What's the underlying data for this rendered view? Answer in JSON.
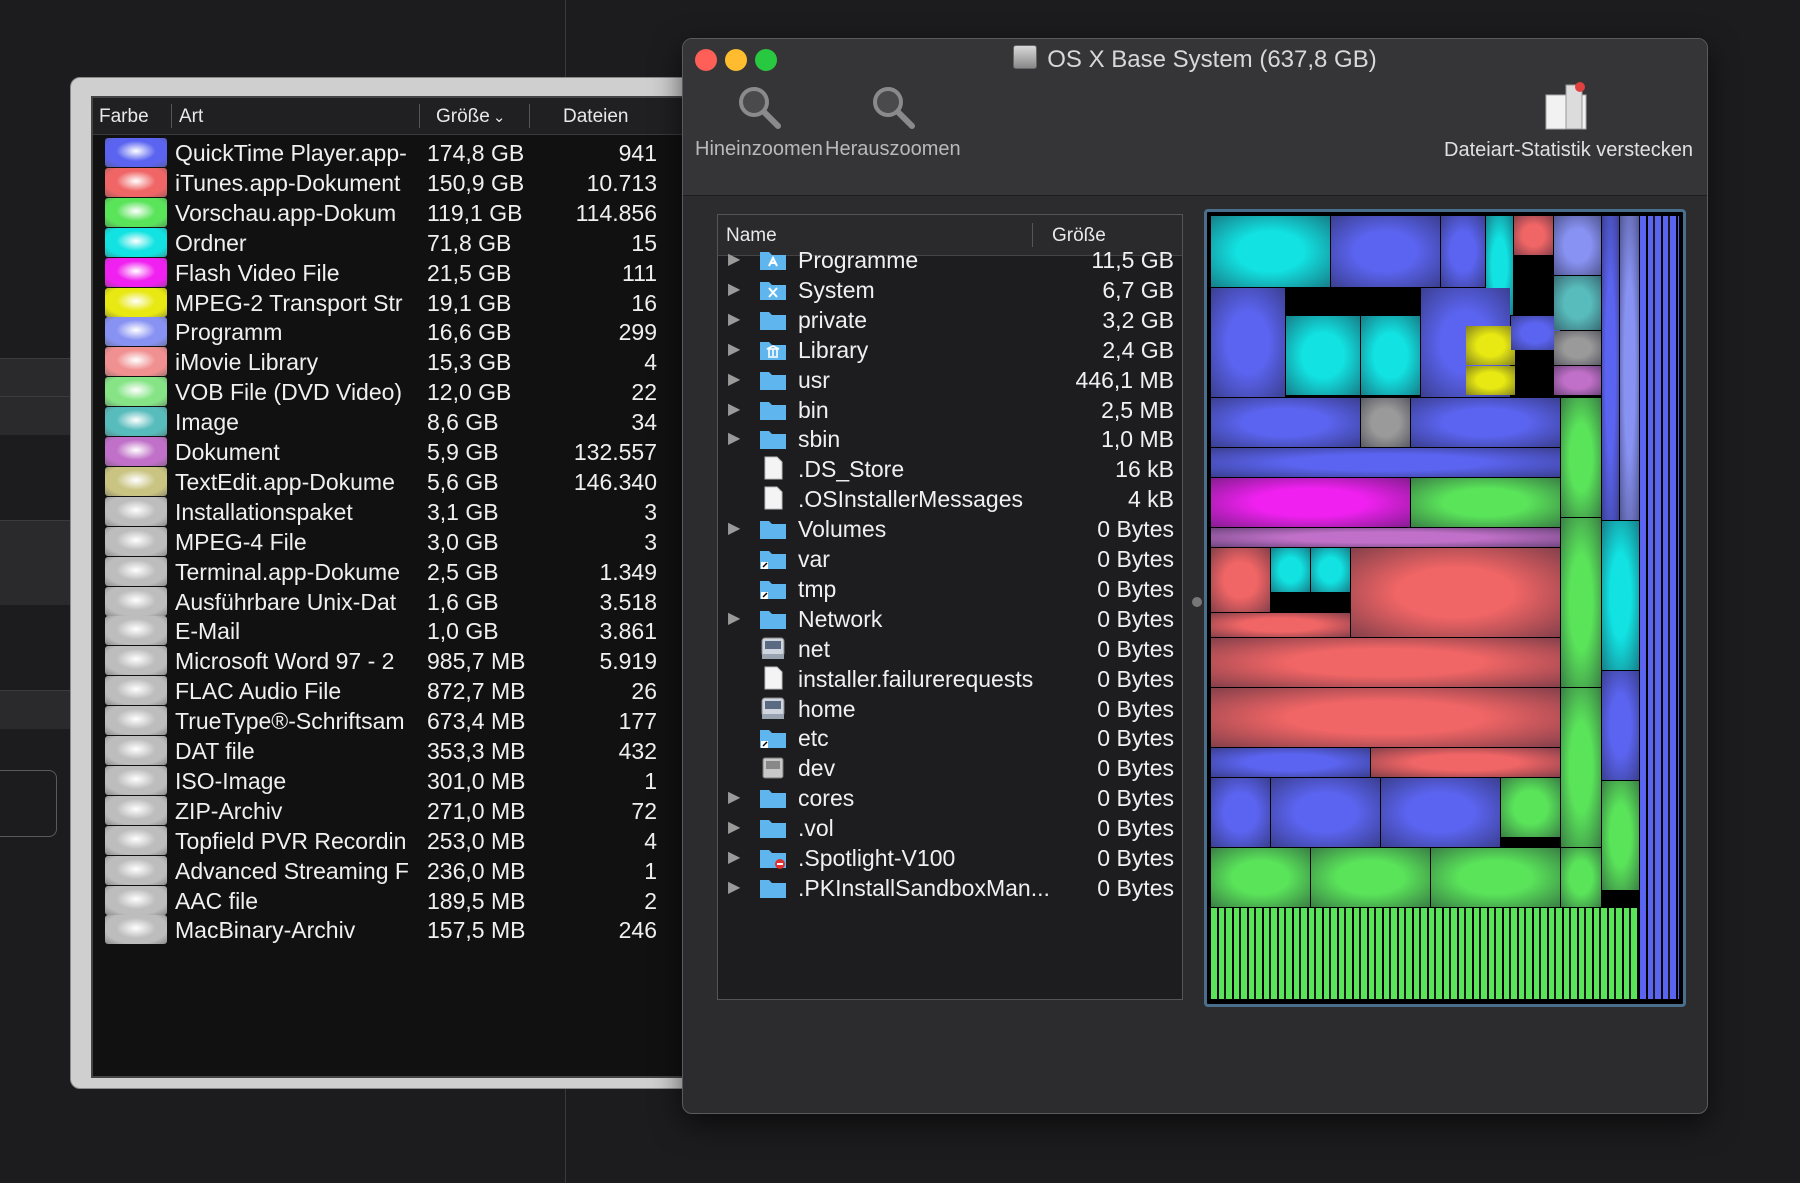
{
  "stats": {
    "headers": {
      "color": "Farbe",
      "type": "Art",
      "size": "Größe",
      "files": "Dateien"
    },
    "rows": [
      {
        "name": "QuickTime Player.app-",
        "size": "174,8 GB",
        "files": "941",
        "color": "#5b64f0"
      },
      {
        "name": "iTunes.app-Dokument",
        "size": "150,9 GB",
        "files": "10.713",
        "color": "#f06565"
      },
      {
        "name": "Vorschau.app-Dokum",
        "size": "119,1 GB",
        "files": "114.856",
        "color": "#5ae45a"
      },
      {
        "name": "Ordner",
        "size": "71,8 GB",
        "files": "15",
        "color": "#12e2e2"
      },
      {
        "name": "Flash Video File",
        "size": "21,5 GB",
        "files": "111",
        "color": "#f020f0"
      },
      {
        "name": "MPEG-2 Transport Str",
        "size": "19,1 GB",
        "files": "16",
        "color": "#e8e812"
      },
      {
        "name": "Programm",
        "size": "16,6 GB",
        "files": "299",
        "color": "#8892f2"
      },
      {
        "name": "iMovie Library",
        "size": "15,3 GB",
        "files": "4",
        "color": "#f09090"
      },
      {
        "name": "VOB File (DVD Video)",
        "size": "12,0 GB",
        "files": "22",
        "color": "#86e486"
      },
      {
        "name": "Image",
        "size": "8,6 GB",
        "files": "34",
        "color": "#58bcbc"
      },
      {
        "name": "Dokument",
        "size": "5,9 GB",
        "files": "132.557",
        "color": "#c070c8"
      },
      {
        "name": "TextEdit.app-Dokume",
        "size": "5,6 GB",
        "files": "146.340",
        "color": "#c9c482"
      },
      {
        "name": "Installationspaket",
        "size": "3,1 GB",
        "files": "3",
        "color": "#bdbdbd"
      },
      {
        "name": "MPEG-4 File",
        "size": "3,0 GB",
        "files": "3",
        "color": "#bdbdbd"
      },
      {
        "name": "Terminal.app-Dokume",
        "size": "2,5 GB",
        "files": "1.349",
        "color": "#bdbdbd"
      },
      {
        "name": "Ausführbare Unix-Dat",
        "size": "1,6 GB",
        "files": "3.518",
        "color": "#bdbdbd"
      },
      {
        "name": "E-Mail",
        "size": "1,0 GB",
        "files": "3.861",
        "color": "#bdbdbd"
      },
      {
        "name": "Microsoft Word 97 - 2",
        "size": "985,7 MB",
        "files": "5.919",
        "color": "#bdbdbd"
      },
      {
        "name": "FLAC Audio File",
        "size": "872,7 MB",
        "files": "26",
        "color": "#bdbdbd"
      },
      {
        "name": "TrueType®-Schriftsam",
        "size": "673,4 MB",
        "files": "177",
        "color": "#bdbdbd"
      },
      {
        "name": "DAT file",
        "size": "353,3 MB",
        "files": "432",
        "color": "#bdbdbd"
      },
      {
        "name": "ISO-Image",
        "size": "301,0 MB",
        "files": "1",
        "color": "#bdbdbd"
      },
      {
        "name": "ZIP-Archiv",
        "size": "271,0 MB",
        "files": "72",
        "color": "#bdbdbd"
      },
      {
        "name": "Topfield PVR Recordin",
        "size": "253,0 MB",
        "files": "4",
        "color": "#bdbdbd"
      },
      {
        "name": "Advanced Streaming F",
        "size": "236,0 MB",
        "files": "1",
        "color": "#bdbdbd"
      },
      {
        "name": "AAC file",
        "size": "189,5 MB",
        "files": "2",
        "color": "#bdbdbd"
      },
      {
        "name": "MacBinary-Archiv",
        "size": "157,5 MB",
        "files": "246",
        "color": "#bdbdbd"
      }
    ]
  },
  "window": {
    "title": "OS X Base System (637,8 GB)",
    "toolbar": {
      "zoom_in": "Hineinzoomen",
      "zoom_out": "Herauszoomen",
      "hide_stats": "Dateiart-Statistik verstecken"
    }
  },
  "files": {
    "headers": {
      "name": "Name",
      "size": "Größe"
    },
    "rows": [
      {
        "name": "Programme",
        "size": "11,5 GB",
        "expandable": true,
        "icon": "apps-folder-icon"
      },
      {
        "name": "System",
        "size": "6,7 GB",
        "expandable": true,
        "icon": "system-folder-icon"
      },
      {
        "name": "private",
        "size": "3,2 GB",
        "expandable": true,
        "icon": "folder-icon"
      },
      {
        "name": "Library",
        "size": "2,4 GB",
        "expandable": true,
        "icon": "library-folder-icon"
      },
      {
        "name": "usr",
        "size": "446,1 MB",
        "expandable": true,
        "icon": "folder-icon"
      },
      {
        "name": "bin",
        "size": "2,5 MB",
        "expandable": true,
        "icon": "folder-icon"
      },
      {
        "name": "sbin",
        "size": "1,0 MB",
        "expandable": true,
        "icon": "folder-icon"
      },
      {
        "name": ".DS_Store",
        "size": "16 kB",
        "expandable": false,
        "icon": "document-icon"
      },
      {
        "name": ".OSInstallerMessages",
        "size": "4 kB",
        "expandable": false,
        "icon": "document-icon"
      },
      {
        "name": "Volumes",
        "size": "0 Bytes",
        "expandable": true,
        "icon": "folder-icon"
      },
      {
        "name": "var",
        "size": "0 Bytes",
        "expandable": false,
        "icon": "alias-folder-icon"
      },
      {
        "name": "tmp",
        "size": "0 Bytes",
        "expandable": false,
        "icon": "alias-folder-icon"
      },
      {
        "name": "Network",
        "size": "0 Bytes",
        "expandable": true,
        "icon": "folder-icon"
      },
      {
        "name": "net",
        "size": "0 Bytes",
        "expandable": false,
        "icon": "server-icon"
      },
      {
        "name": "installer.failurerequests",
        "size": "0 Bytes",
        "expandable": false,
        "icon": "document-icon"
      },
      {
        "name": "home",
        "size": "0 Bytes",
        "expandable": false,
        "icon": "server-icon"
      },
      {
        "name": "etc",
        "size": "0 Bytes",
        "expandable": false,
        "icon": "alias-folder-icon"
      },
      {
        "name": "dev",
        "size": "0 Bytes",
        "expandable": false,
        "icon": "disk-icon"
      },
      {
        "name": "cores",
        "size": "0 Bytes",
        "expandable": true,
        "icon": "folder-icon"
      },
      {
        "name": ".vol",
        "size": "0 Bytes",
        "expandable": true,
        "icon": "folder-icon"
      },
      {
        "name": ".Spotlight-V100",
        "size": "0 Bytes",
        "expandable": true,
        "icon": "restricted-folder-icon"
      },
      {
        "name": ".PKInstallSandboxMan...",
        "size": "0 Bytes",
        "expandable": true,
        "icon": "folder-icon"
      }
    ]
  },
  "colors": {
    "folder": "#5fb6ee",
    "close": "#fe5f57",
    "minimize": "#febc2e",
    "zoom": "#28c840",
    "treemap_border": "#4a6f8c"
  }
}
